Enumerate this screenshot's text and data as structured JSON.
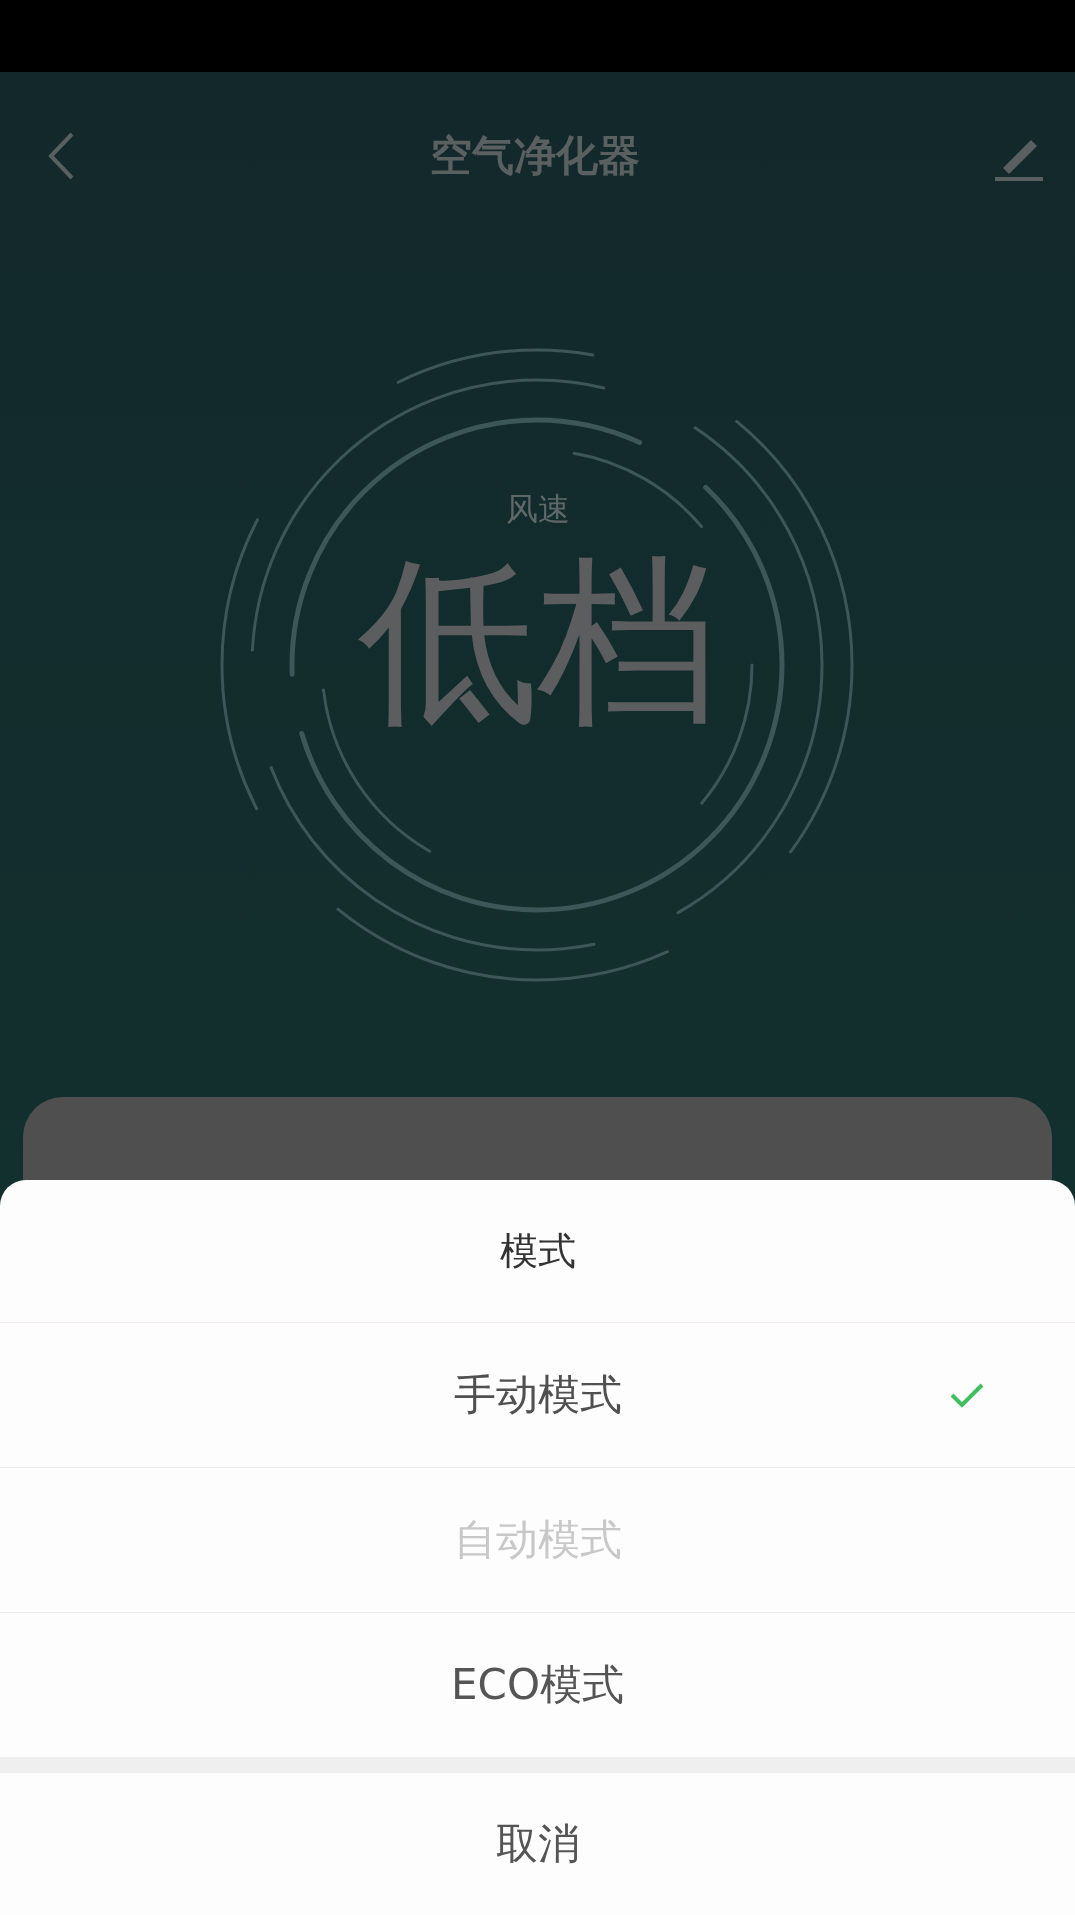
{
  "nav": {
    "title": "空气净化器"
  },
  "speed": {
    "label": "风速",
    "value": "低档"
  },
  "sheet": {
    "title": "模式",
    "options": [
      {
        "label": "手动模式",
        "selected": true,
        "disabled": false
      },
      {
        "label": "自动模式",
        "selected": false,
        "disabled": true
      },
      {
        "label": "ECO模式",
        "selected": false,
        "disabled": false
      }
    ],
    "cancel": "取消"
  }
}
